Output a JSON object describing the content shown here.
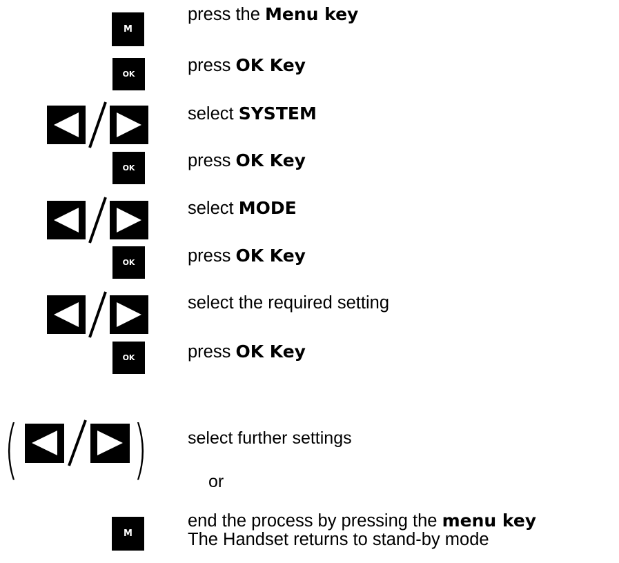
{
  "keys": {
    "menu_label": "M",
    "ok_label": "OK"
  },
  "steps": [
    {
      "pre": "press the ",
      "bold": "Menu key"
    },
    {
      "pre": "press ",
      "bold": "OK Key"
    },
    {
      "pre": "select ",
      "bold": "SYSTEM"
    },
    {
      "pre": "press ",
      "bold": "OK Key"
    },
    {
      "pre": "select ",
      "bold": "MODE"
    },
    {
      "pre": "press ",
      "bold": "OK Key"
    },
    {
      "pre": "select the required setting",
      "bold": ""
    },
    {
      "pre": "press ",
      "bold": "OK Key"
    }
  ],
  "optional": {
    "further_text": "select further settings",
    "or_text": "or",
    "paren_left": "(",
    "paren_right": ")"
  },
  "end": {
    "pre": "end the process by pressing the ",
    "bold": "menu key",
    "line2": "The Handset returns to stand-by mode"
  },
  "icons": {
    "arrow_left": "left-arrow-key-icon",
    "arrow_right": "right-arrow-key-icon",
    "separator": "/"
  }
}
